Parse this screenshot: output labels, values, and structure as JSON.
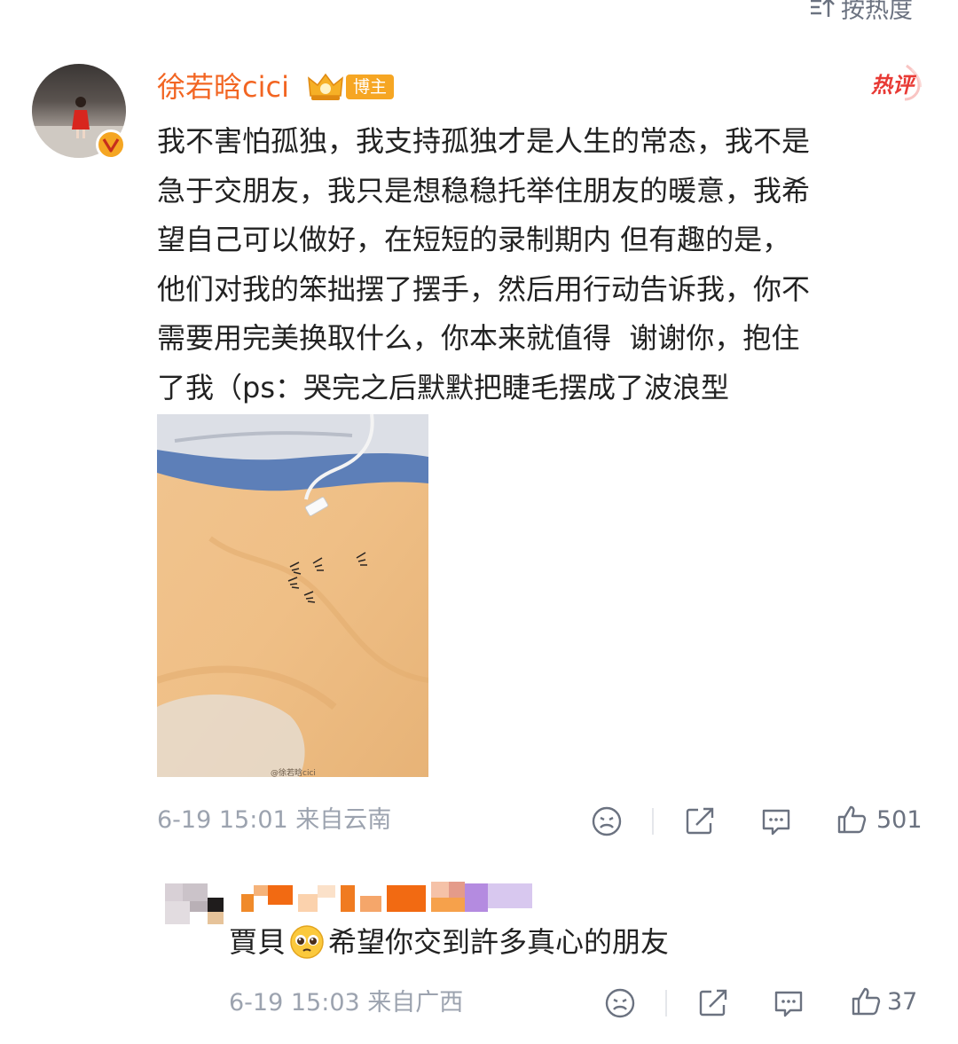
{
  "sort": {
    "label": "按热度",
    "icon": "sort-icon"
  },
  "post": {
    "username": "徐若晗cici",
    "badge_label": "博主",
    "hot_label": "热评",
    "verified_icon": "verified-v-icon",
    "text": "我不害怕孤独，我支持孤独才是人生的常态，我不是\n急于交朋友，我只是想稳稳托举住朋友的暖意，我希\n望自己可以做好，在短短的录制期内 但有趣的是，\n他们对我的笨拙摆了摆手，然后用行动告诉我，你不\n需要用完美换取什么，你本来就值得  谢谢你，抱住\n了我（ps：哭完之后默默把睫毛摆成了波浪型",
    "image_watermark": "@徐若晗cici",
    "meta": "6-19 15:01 来自云南",
    "like_count": "501"
  },
  "comment": {
    "text_before": "賈貝",
    "emoji": "pleading-face-emoji",
    "text_after": "希望你交到許多真心的朋友",
    "meta": "6-19 15:03 来自广西",
    "like_count": "37"
  },
  "colors": {
    "username": "#f26522",
    "badge": "#f6a623",
    "hot": "#e83a35",
    "meta": "#9ca3af",
    "icon": "#6b7280"
  }
}
